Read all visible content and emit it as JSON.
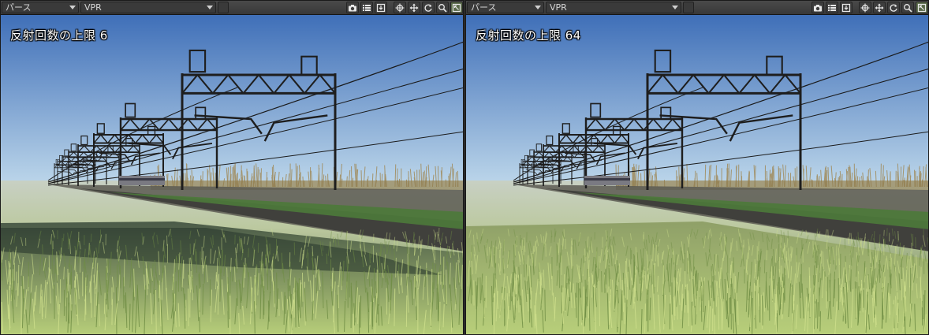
{
  "viewports": [
    {
      "view_mode": "パース",
      "render_mode": "VPR",
      "overlay_text": "反射回数の上限  6",
      "grass_style": "reflective-water"
    },
    {
      "view_mode": "パース",
      "render_mode": "VPR",
      "overlay_text": "反射回数の上限  64",
      "grass_style": "dense-grass"
    }
  ],
  "toolbar_icons": [
    "camera-icon",
    "list-icon",
    "save-icon",
    "center-icon",
    "move-icon",
    "rotate-icon",
    "zoom-icon",
    "maximize-icon"
  ],
  "colors": {
    "sky_top": "#3f6fb8",
    "sky_bottom": "#bcd6ea",
    "grass_light": "#b8cf7a",
    "grass_dark": "#506a3a",
    "structure": "#1e1e1e"
  }
}
